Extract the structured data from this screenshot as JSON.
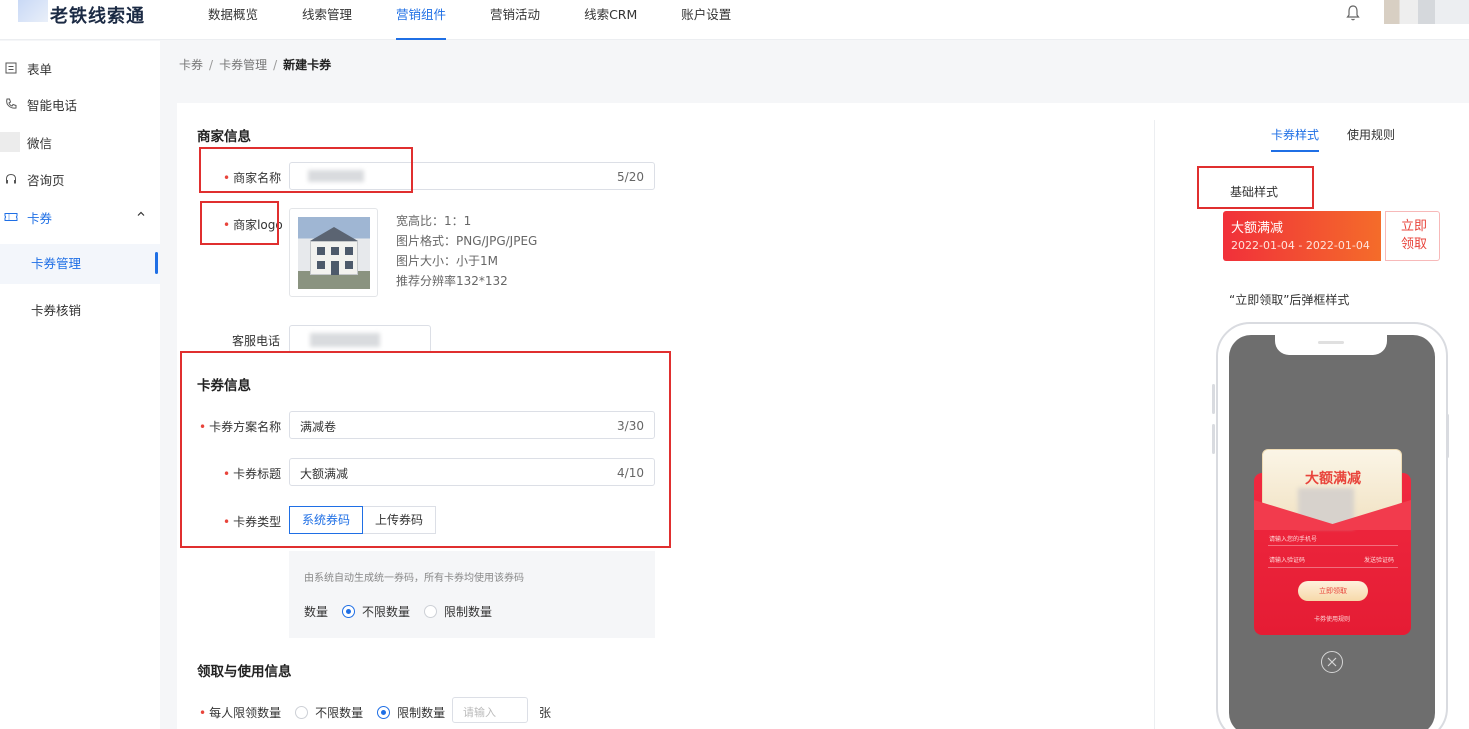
{
  "app": {
    "title": "老铁线索通"
  },
  "nav": {
    "items": [
      {
        "label": "数据概览",
        "active": false
      },
      {
        "label": "线索管理",
        "active": false
      },
      {
        "label": "营销组件",
        "active": true
      },
      {
        "label": "营销活动",
        "active": false
      },
      {
        "label": "线索CRM",
        "active": false
      },
      {
        "label": "账户设置",
        "active": false
      }
    ],
    "icons": [
      "bell-icon",
      "avatar"
    ]
  },
  "sidebar": {
    "items": [
      {
        "label": "表单",
        "icon": "form-icon"
      },
      {
        "label": "智能电话",
        "icon": "phone-icon"
      },
      {
        "label": "微信",
        "icon": "wechat-icon"
      },
      {
        "label": "咨询页",
        "icon": "headset-icon"
      },
      {
        "label": "卡券",
        "icon": "ticket-icon",
        "expanded": true
      }
    ],
    "sub_items": [
      {
        "label": "卡券管理",
        "active": true
      },
      {
        "label": "卡券核销",
        "active": false
      }
    ]
  },
  "breadcrumb": {
    "items": [
      "卡券",
      "卡券管理"
    ],
    "current": "新建卡券",
    "separator": "/"
  },
  "merchant": {
    "section_title": "商家信息",
    "name_label": "商家名称",
    "name_count": "5/20",
    "logo_label": "商家logo",
    "logo_hints": [
      "宽高比：1：1",
      "图片格式：PNG/JPG/JPEG",
      "图片大小：小于1M",
      "推荐分辨率132*132"
    ],
    "phone_label": "客服电话"
  },
  "coupon_info": {
    "section_title": "卡券信息",
    "plan_name_label": "卡券方案名称",
    "plan_name_value": "满减卷",
    "plan_name_count": "3/30",
    "title_label": "卡券标题",
    "title_value": "大额满减",
    "title_count": "4/10",
    "type_label": "卡券类型",
    "type_options": [
      {
        "label": "系统券码",
        "active": true
      },
      {
        "label": "上传券码",
        "active": false
      }
    ],
    "type_desc": "由系统自动生成统一券码，所有卡券均使用该券码",
    "quantity_label": "数量",
    "quantity_options": [
      {
        "label": "不限数量",
        "checked": true
      },
      {
        "label": "限制数量",
        "checked": false
      }
    ]
  },
  "claim_info": {
    "section_title": "领取与使用信息",
    "per_person_label": "每人限领数量",
    "per_person_options": [
      {
        "label": "不限数量",
        "checked": false
      },
      {
        "label": "限制数量",
        "checked": true
      }
    ],
    "per_person_placeholder": "请输入",
    "per_person_unit": "张"
  },
  "preview": {
    "tabs": [
      {
        "label": "卡券样式",
        "active": true
      },
      {
        "label": "使用规则",
        "active": false
      }
    ],
    "basic_style_label": "基础样式",
    "coupon_title": "大额满减",
    "coupon_date": "2022-01-04 - 2022-01-04",
    "coupon_action": "立即领取",
    "popup_style_label": "“立即领取”后弹框样式",
    "popup": {
      "card_title": "大额满减",
      "phone_placeholder": "请输入您的手机号",
      "code_placeholder": "请输入验证码",
      "send_code": "发送验证码",
      "claim_button": "立即领取",
      "rules_link": "卡券使用规则"
    }
  },
  "colors": {
    "primary": "#1f6fe5",
    "required": "#e8443b",
    "highlight_box": "#e02f2f",
    "coupon_red": "#f1303a"
  }
}
